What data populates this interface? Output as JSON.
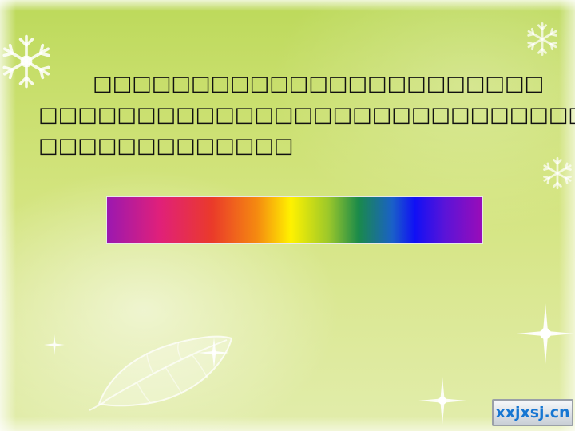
{
  "slide": {
    "paragraph": {
      "lines": [
        "□□□□□□□□□□□□□□□□□□□□□□□",
        "□□□□□□□□□□□□□□□□□□□□□□□□□□□□",
        "□□□□□□□□□□□□□"
      ]
    },
    "spectrum": {
      "colors": [
        "#9b18b0",
        "#e0207a",
        "#ea3a2a",
        "#f58a10",
        "#fff200",
        "#9cc82a",
        "#1a8a4a",
        "#1a60c8",
        "#1010f5",
        "#5a14d8",
        "#9a0cb8"
      ]
    },
    "watermark": {
      "text": "xxjxsj.cn"
    }
  },
  "decorations": {
    "snowflakes": [
      "snowflake-icon",
      "snowflake-icon",
      "snowflake-icon"
    ],
    "sparkles": [
      "sparkle-icon",
      "sparkle-icon",
      "sparkle-icon",
      "sparkle-icon"
    ],
    "leaf": "leaf-icon"
  }
}
